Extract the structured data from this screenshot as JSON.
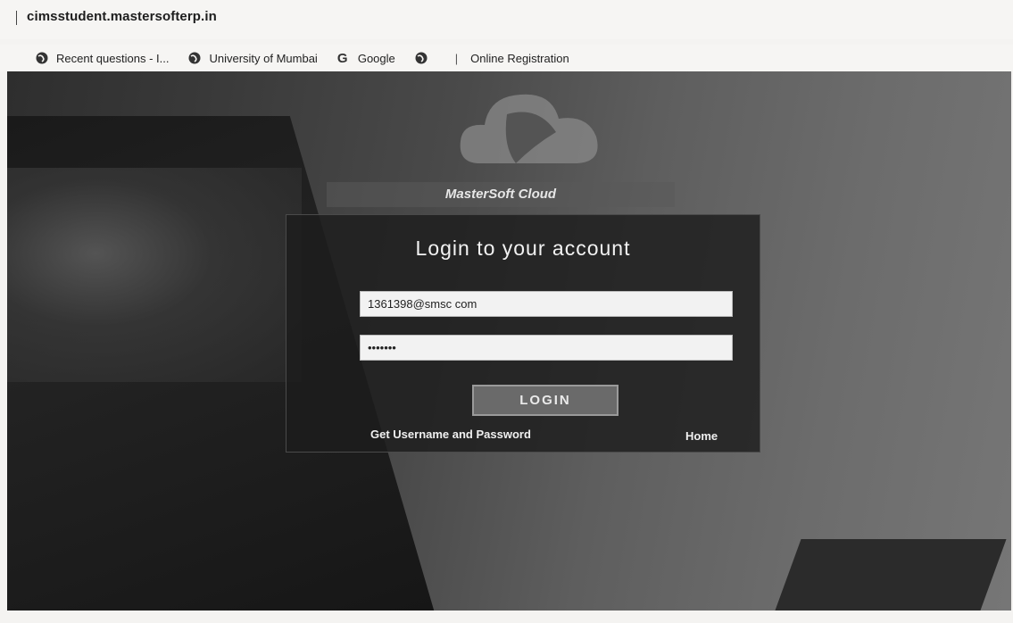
{
  "browser": {
    "url": "cimsstudent.mastersofterp.in",
    "bookmarks": [
      {
        "label": "Recent questions - I...",
        "icon": "globe-icon"
      },
      {
        "label": "University of Mumbai",
        "icon": "globe-icon"
      },
      {
        "label": "Google",
        "icon": "google-icon"
      },
      {
        "label": "",
        "icon": "globe-icon"
      },
      {
        "label": "Online Registration",
        "icon": "page-icon"
      }
    ]
  },
  "login": {
    "brand": "MasterSoft Cloud",
    "title": "Login to your account",
    "username_value": "1361398@smsc com",
    "password_value": "•••••••",
    "login_button": "LOGIN",
    "get_credentials_link": "Get Username and Password",
    "home_link": "Home"
  },
  "colors": {
    "panel": "#1c1c1c",
    "button": "#6a6a6a",
    "field": "#f2f2f2"
  }
}
